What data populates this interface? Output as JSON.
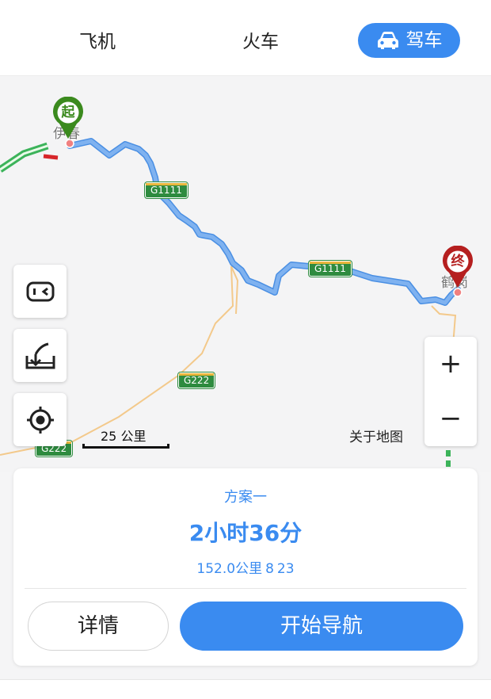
{
  "tabs": {
    "flight": "飞机",
    "train": "火车",
    "drive": "驾车"
  },
  "map": {
    "start_city": "伊春",
    "end_city": "鹤岗",
    "start_marker": "起",
    "end_marker": "终",
    "road_labels": [
      "G1111",
      "G1111",
      "G222",
      "G222"
    ],
    "scale": "25 公里",
    "about": "关于地图"
  },
  "route_plan": {
    "name": "方案一",
    "duration": "2小时36分",
    "distance": "152.0公里",
    "extra": "8",
    "extra_suffix": "23"
  },
  "actions": {
    "details": "详情",
    "start_navigation": "开始导航"
  },
  "icons": {
    "drive": "car-icon",
    "toggle": "traffic-toggle-icon",
    "offline": "download-icon",
    "locate": "locate-icon"
  },
  "colors": {
    "accent": "#3a8bf0",
    "route": "#6aa5ea",
    "start_pin": "#3b8a1e",
    "end_pin": "#b51f1f",
    "road_badge": "#2e8b3f"
  }
}
